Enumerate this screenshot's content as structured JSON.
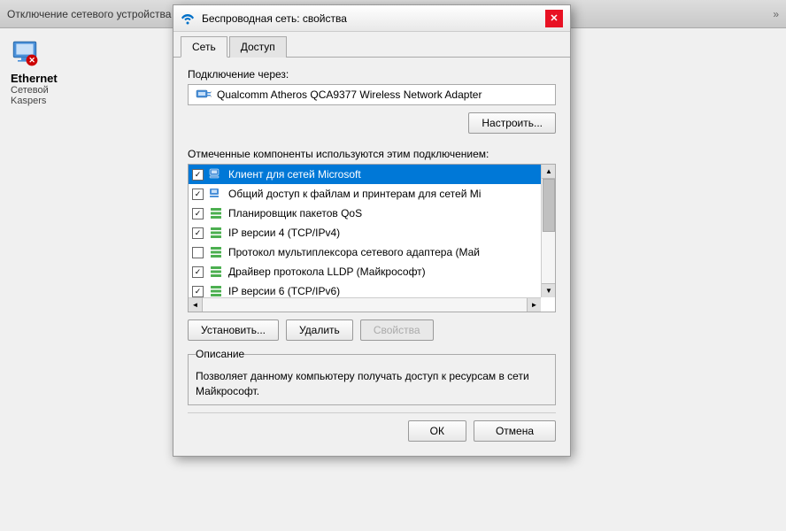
{
  "bg_window": {
    "title": "Отключение сетевого устройства",
    "network_name": "Ethernet",
    "network_sub1": "Сетевой",
    "network_sub2": "Kaspers"
  },
  "modal": {
    "title": "Беспроводная сеть: свойства",
    "tabs": [
      {
        "label": "Сеть",
        "active": true
      },
      {
        "label": "Доступ",
        "active": false
      }
    ],
    "connection_via_label": "Подключение через:",
    "adapter_name": "Qualcomm Atheros QCA9377 Wireless Network Adapter",
    "configure_btn": "Настроить...",
    "components_label": "Отмеченные компоненты используются этим подключением:",
    "components": [
      {
        "checked": true,
        "selected": true,
        "icon": "network",
        "label": "Клиент для сетей Microsoft"
      },
      {
        "checked": true,
        "selected": false,
        "icon": "network",
        "label": "Общий доступ к файлам и принтерам для сетей Mi"
      },
      {
        "checked": true,
        "selected": false,
        "icon": "stack",
        "label": "Планировщик пакетов QoS"
      },
      {
        "checked": true,
        "selected": false,
        "icon": "stack",
        "label": "IP версии 4 (TCP/IPv4)"
      },
      {
        "checked": false,
        "selected": false,
        "icon": "stack",
        "label": "Протокол мультиплексора сетевого адаптера (Май"
      },
      {
        "checked": true,
        "selected": false,
        "icon": "stack",
        "label": "Драйвер протокола LLDP (Майкрософт)"
      },
      {
        "checked": true,
        "selected": false,
        "icon": "stack",
        "label": "IP версии 6 (TCP/IPv6)"
      }
    ],
    "install_btn": "Установить...",
    "uninstall_btn": "Удалить",
    "properties_btn": "Свойства",
    "description_label": "Описание",
    "description_text": "Позволяет данному компьютеру получать доступ к ресурсам в сети Майкрософт.",
    "ok_btn": "ОК",
    "cancel_btn": "Отмена"
  }
}
